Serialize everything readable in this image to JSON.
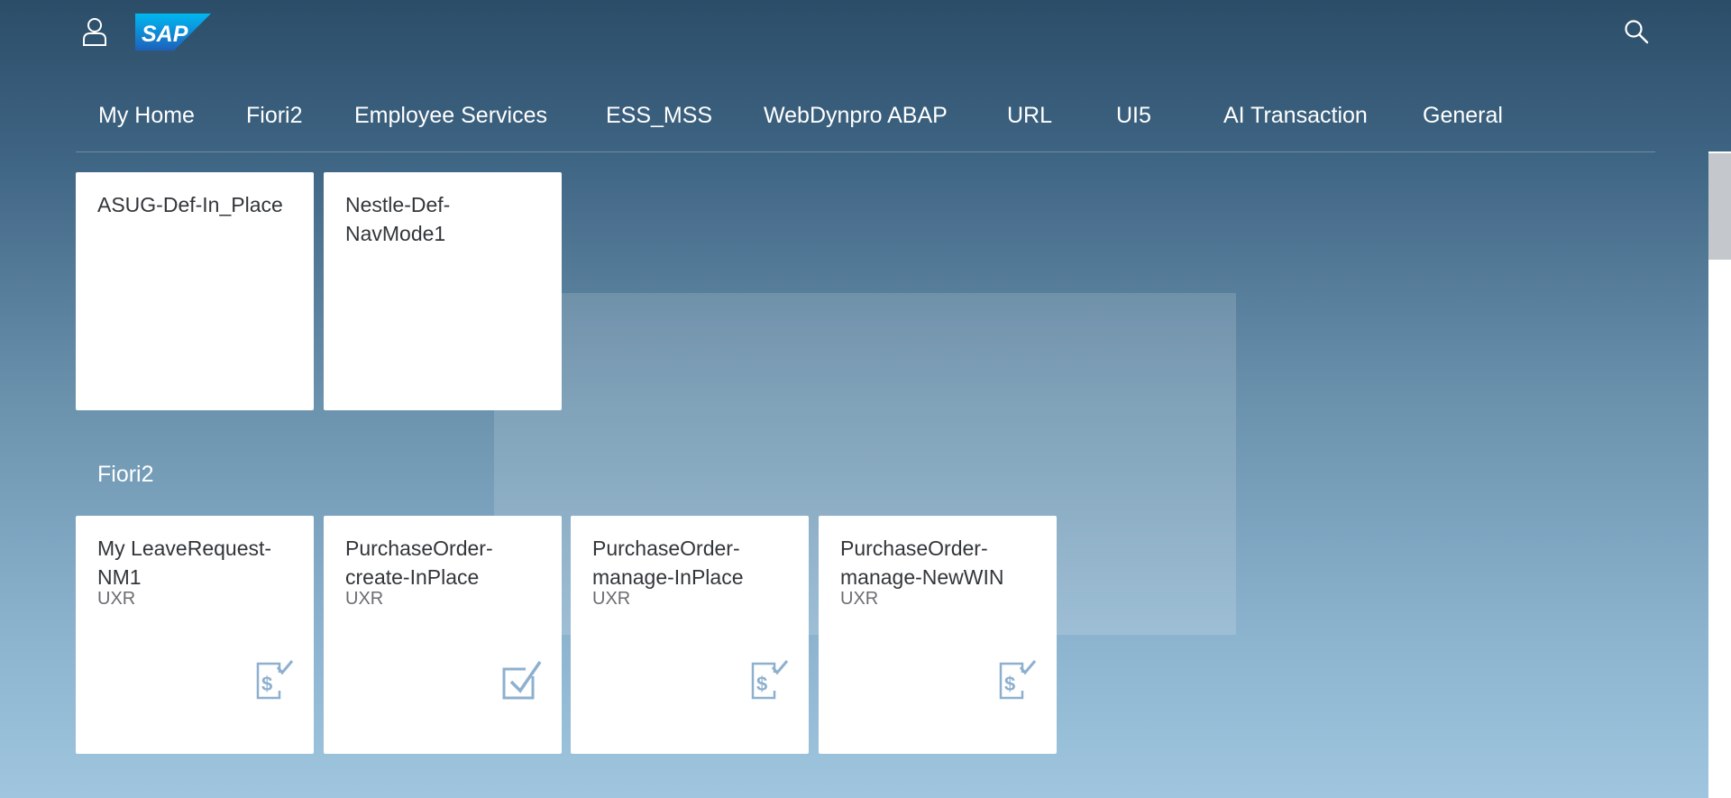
{
  "header": {
    "logo_text": "SAP",
    "user_icon": "user-icon",
    "search_icon": "search-icon"
  },
  "nav": {
    "tabs": [
      {
        "label": "My Home"
      },
      {
        "label": "Fiori2"
      },
      {
        "label": "Employee Services"
      },
      {
        "label": "ESS_MSS"
      },
      {
        "label": "WebDynpro ABAP"
      },
      {
        "label": "URL"
      },
      {
        "label": "UI5"
      },
      {
        "label": "AI Transaction"
      },
      {
        "label": "General"
      }
    ]
  },
  "groups": {
    "top": {
      "tiles": [
        {
          "title": "ASUG-Def-In_Place"
        },
        {
          "title": "Nestle-Def-NavMode1"
        }
      ]
    },
    "fiori2": {
      "title": "Fiori2",
      "tiles": [
        {
          "title": "My LeaveRequest-NM1",
          "subtitle": "UXR",
          "icon": "dollar-check-icon"
        },
        {
          "title": "PurchaseOrder-create-InPlace",
          "subtitle": "UXR",
          "icon": "checkbox-icon"
        },
        {
          "title": "PurchaseOrder-manage-InPlace",
          "subtitle": "UXR",
          "icon": "dollar-check-icon"
        },
        {
          "title": "PurchaseOrder-manage-NewWIN",
          "subtitle": "UXR",
          "icon": "dollar-check-icon"
        }
      ]
    }
  },
  "colors": {
    "header_bg": "#2b4d68",
    "tile_bg": "#ffffff",
    "icon_color": "#8eb0cf",
    "sap_blue": "#1b9fe2"
  }
}
